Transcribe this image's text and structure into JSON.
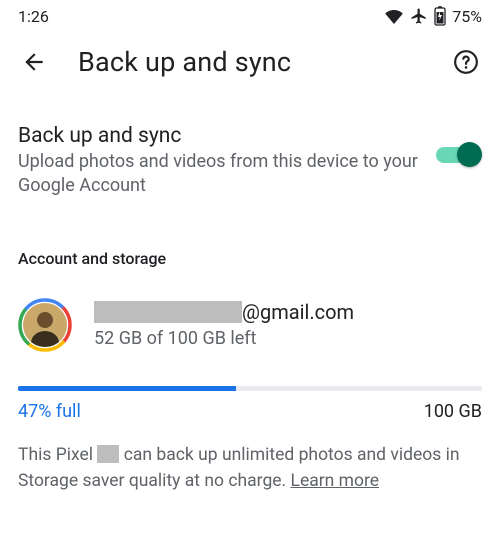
{
  "status": {
    "time": "1:26",
    "battery": "75%"
  },
  "header": {
    "title": "Back up and sync"
  },
  "toggle": {
    "title": "Back up and sync",
    "description": "Upload photos and videos from this device to your Google Account",
    "enabled": true
  },
  "account_section": {
    "subheader": "Account and storage",
    "email_suffix": "@gmail.com",
    "storage_left": "52 GB of 100 GB left"
  },
  "storage": {
    "percent_full_label": "47% full",
    "percent_full": 47,
    "capacity": "100 GB"
  },
  "footnote": {
    "prefix": "This Pixel ",
    "rest": " can back up unlimited photos and videos in Storage saver quality at no charge. ",
    "learn_more": "Learn more"
  }
}
